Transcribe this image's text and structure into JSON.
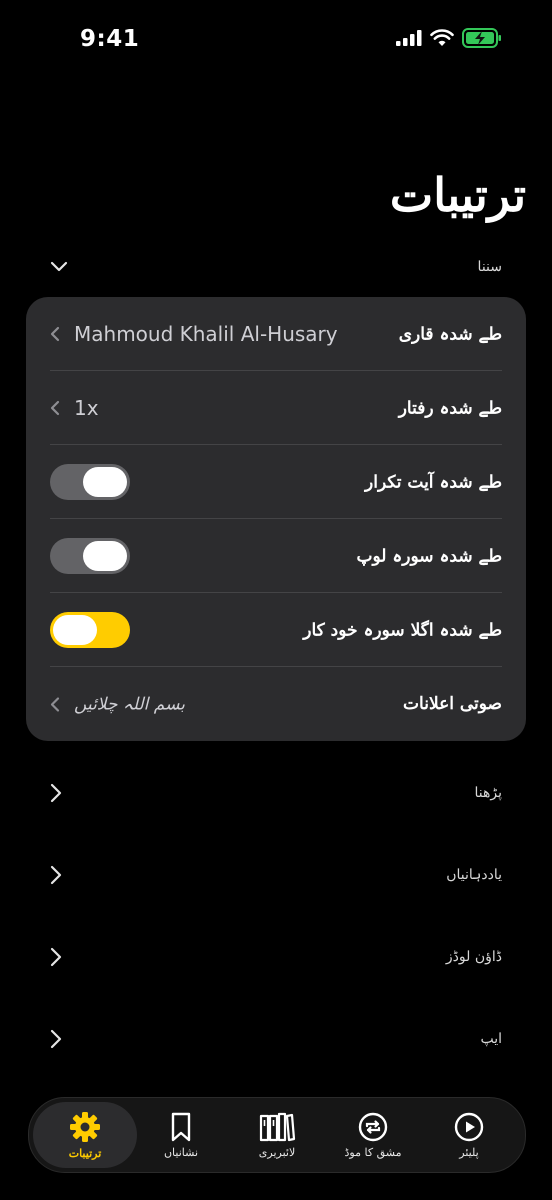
{
  "status": {
    "time": "9:41"
  },
  "title": "ترتیبات",
  "sections": {
    "listening": "سننا",
    "reading": "پڑھنا",
    "bookmarks": "یاددہانیاں",
    "downloads": "ڈاؤن لوڈز",
    "app": "ایپ"
  },
  "card": {
    "reciter": {
      "label": "طے شدہ قاری",
      "value": "Mahmoud Khalil Al-Husary"
    },
    "speed": {
      "label": "طے شدہ رفتار",
      "value": "1x"
    },
    "repeat_ayah": {
      "label": "طے شدہ آیت تکرار",
      "on": false
    },
    "surah_loop": {
      "label": "طے شدہ سورہ لوپ",
      "on": false
    },
    "autoplay_next": {
      "label": "طے شدہ اگلا سورہ خود کار",
      "on": true
    },
    "audio_announcements": {
      "label": "صوتی اعلانات",
      "value": "بسم اللہ چلائیں"
    }
  },
  "tabs": [
    {
      "label": "ترتیبات",
      "icon": "gear-icon",
      "active": true
    },
    {
      "label": "نشانیاں",
      "icon": "bookmark-icon",
      "active": false
    },
    {
      "label": "لائبریری",
      "icon": "library-icon",
      "active": false
    },
    {
      "label": "مشق کا موڈ",
      "icon": "repeat-icon",
      "active": false
    },
    {
      "label": "پلیئر",
      "icon": "play-icon",
      "active": false
    }
  ],
  "colors": {
    "accent": "#ffcc00",
    "card": "#2c2c2e",
    "battery": "#34c759"
  }
}
